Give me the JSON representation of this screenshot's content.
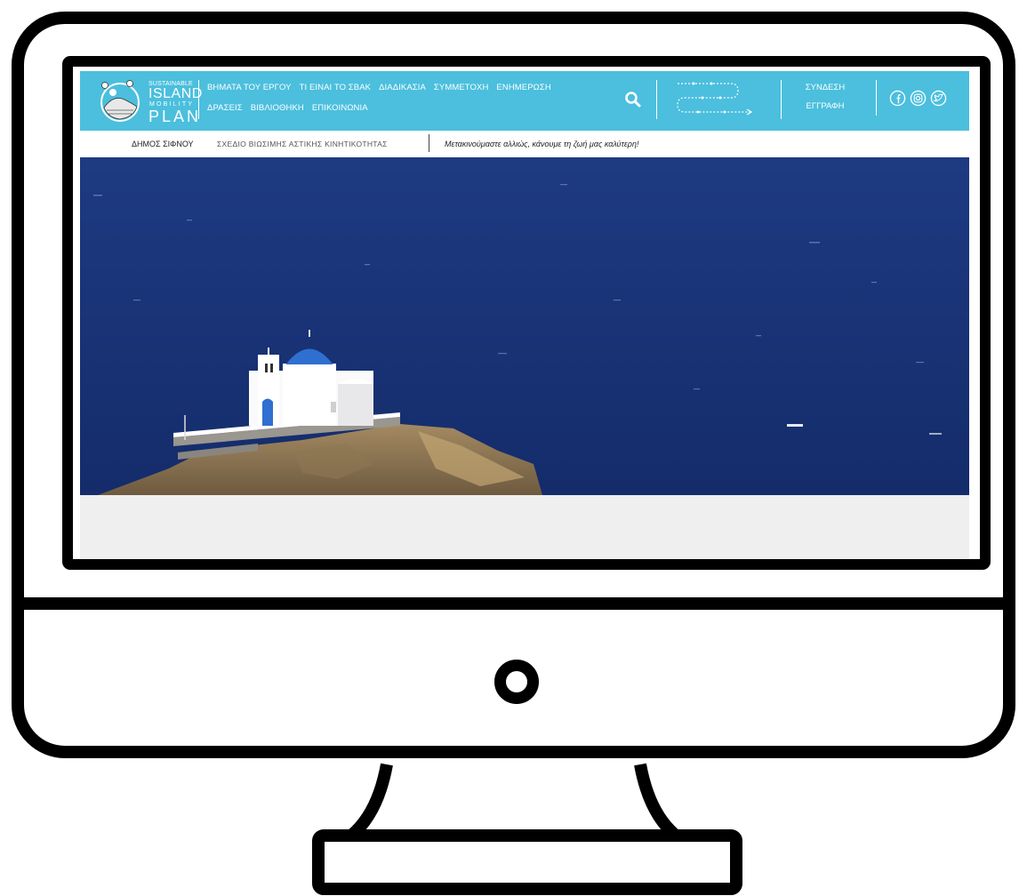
{
  "site": {
    "colors": {
      "header_bg": "#4bbfdd",
      "sea": "#1b357a",
      "dome": "#2f6fd0",
      "content_bg": "#efefef"
    },
    "logo": {
      "small": "SUSTAINABLE",
      "island": "ISLAND",
      "mobility": "MOBILITY",
      "plan": "PLAN"
    },
    "nav": {
      "row1": [
        "ΒΗΜΑΤΑ ΤΟΥ ΕΡΓΟΥ",
        "ΤΙ ΕΙΝΑΙ ΤΟ ΣΒΑΚ",
        "ΔΙΑΔΙΚΑΣΙΑ",
        "ΣΥΜΜΕΤΟΧΗ",
        "ΕΝΗΜΕΡΩΣΗ"
      ],
      "row2": [
        "ΔΡΑΣΕΙΣ",
        "ΒΙΒΛΙΟΘΗΚΗ",
        "ΕΠΙΚΟΙΝΩΝΙΑ"
      ]
    },
    "icons": {
      "search": "search-icon",
      "route": "route-icon",
      "social": [
        "facebook-icon",
        "instagram-icon",
        "twitter-icon"
      ]
    },
    "auth": {
      "login": "ΣΥΝΔΕΣΗ",
      "register": "ΕΓΓΡΑΦΗ"
    },
    "subbar": {
      "municipality": "ΔΗΜΟΣ ΣΙΦΝΟΥ",
      "plan_title": "ΣΧΕΔΙΟ ΒΙΩΣΙΜΗΣ ΑΣΤΙΚΗΣ ΚΙΝΗΤΙΚΟΤΗΤΑΣ",
      "tagline": "Μετακινούμαστε αλλιώς, κάνουμε τη ζωή μας καλύτερη!"
    }
  }
}
